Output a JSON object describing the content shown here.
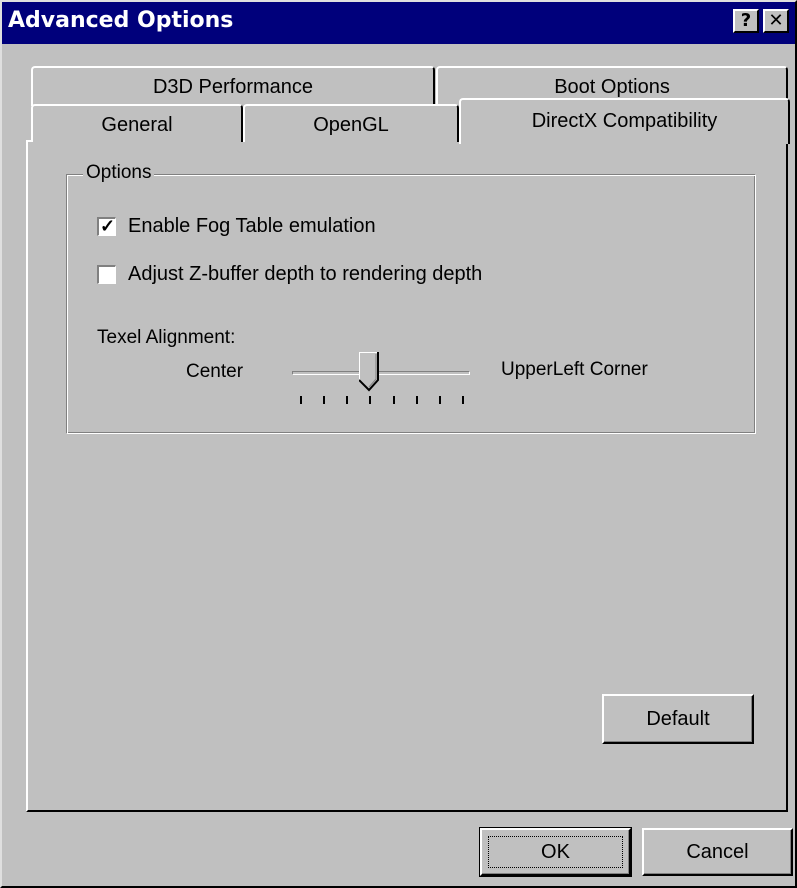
{
  "window": {
    "title": "Advanced Options",
    "help_glyph": "?",
    "close_glyph": "✕"
  },
  "tabs": {
    "row_back": [
      {
        "label": "D3D Performance"
      },
      {
        "label": "Boot Options"
      }
    ],
    "row_front": [
      {
        "label": "General"
      },
      {
        "label": "OpenGL"
      },
      {
        "label": "DirectX Compatibility",
        "active": true
      }
    ]
  },
  "options_group": {
    "title": "Options",
    "fog_table": {
      "label": "Enable Fog Table emulation",
      "checked": true
    },
    "zbuffer": {
      "label": "Adjust Z-buffer depth to rendering depth",
      "checked": false
    },
    "texel": {
      "label": "Texel Alignment:",
      "min_label": "Center",
      "max_label": "UpperLeft Corner",
      "tick_count": 8,
      "value_index": 3
    }
  },
  "buttons": {
    "default": "Default",
    "ok": "OK",
    "cancel": "Cancel"
  },
  "colors": {
    "title_bar": "#00007b",
    "face": "#c0c0c0"
  }
}
